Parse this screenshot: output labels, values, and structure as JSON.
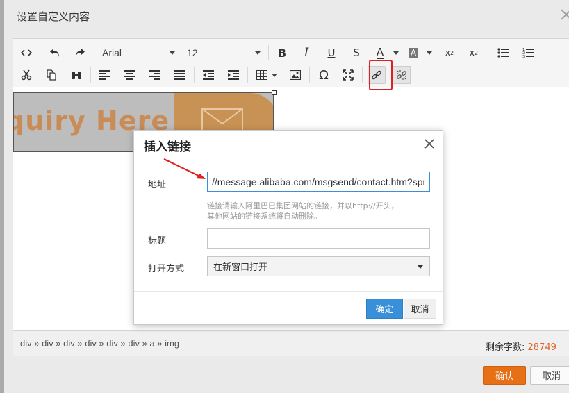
{
  "outer_dialog": {
    "title": "设置自定义内容",
    "confirm_label": "确认",
    "cancel_label": "取消"
  },
  "toolbar": {
    "font_family": "Arial",
    "font_size": "12",
    "icons": [
      "source-code-icon",
      "undo-icon",
      "redo-icon",
      "bold-icon",
      "italic-icon",
      "underline-icon",
      "strikethrough-icon",
      "font-color-icon",
      "background-color-icon",
      "superscript-icon",
      "subscript-icon",
      "unordered-list-icon",
      "ordered-list-icon",
      "cut-icon",
      "copy-icon",
      "find-icon",
      "align-left-icon",
      "align-center-icon",
      "align-right-icon",
      "align-justify-icon",
      "outdent-icon",
      "indent-icon",
      "table-icon",
      "image-icon",
      "special-char-icon",
      "fullscreen-icon",
      "link-icon",
      "unlink-icon"
    ]
  },
  "content": {
    "banner_text": "quiry Here"
  },
  "statusbar": {
    "element_path": "div » div » div » div » div » div » a » img",
    "word_count_label": "剩余字数:",
    "word_count_value": "28749"
  },
  "modal": {
    "title": "插入链接",
    "url_label": "地址",
    "url_value": "//message.alibaba.com/msgsend/contact.htm?spn",
    "hint_line1": "链接请输入阿里巴巴集团网站的链接，并以http://开头，",
    "hint_line2": "其他网站的链接系统将自动删除。",
    "title_label": "标题",
    "title_value": "",
    "open_label": "打开方式",
    "open_value": "在新窗口打开",
    "ok_label": "确定",
    "cancel_label": "取消"
  },
  "colors": {
    "accent_blue": "#3a8fd9",
    "confirm_orange": "#e76f16",
    "highlight_red": "#e02020",
    "word_count_orange": "#e0622a"
  }
}
